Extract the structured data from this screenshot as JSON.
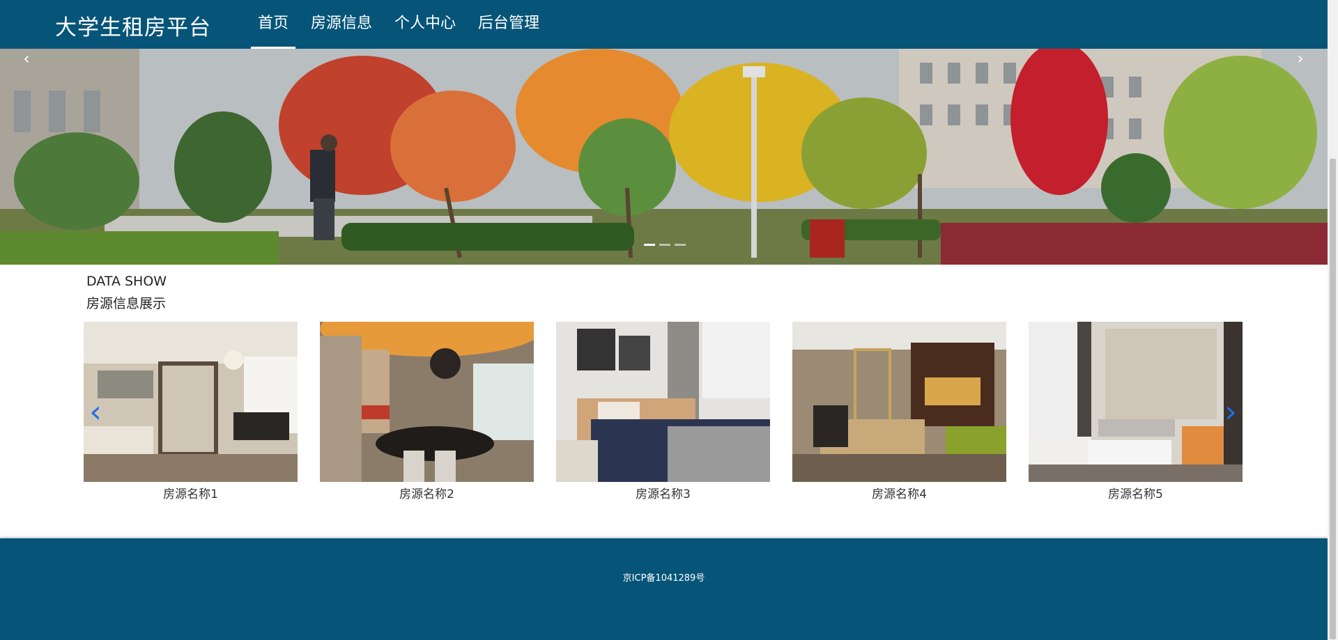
{
  "header": {
    "brand": "大学生租房平台",
    "nav": [
      {
        "label": "首页",
        "active": true
      },
      {
        "label": "房源信息",
        "active": false
      },
      {
        "label": "个人中心",
        "active": false
      },
      {
        "label": "后台管理",
        "active": false
      }
    ]
  },
  "banner": {
    "prev_icon": "chevron-left-icon",
    "next_icon": "chevron-right-icon",
    "slide_count": 3,
    "active_slide": 0
  },
  "section": {
    "title_en": "DATA SHOW",
    "title_cn": "房源信息展示"
  },
  "carousel": {
    "prev_icon": "chevron-left-icon",
    "next_icon": "chevron-right-icon",
    "arrow_color": "#1e6fe8",
    "items": [
      {
        "name": "房源名称1"
      },
      {
        "name": "房源名称2"
      },
      {
        "name": "房源名称3"
      },
      {
        "name": "房源名称4"
      },
      {
        "name": "房源名称5"
      }
    ]
  },
  "footer": {
    "icp": "京ICP备1041289号"
  },
  "colors": {
    "primary": "#065579",
    "text": "#333333"
  }
}
